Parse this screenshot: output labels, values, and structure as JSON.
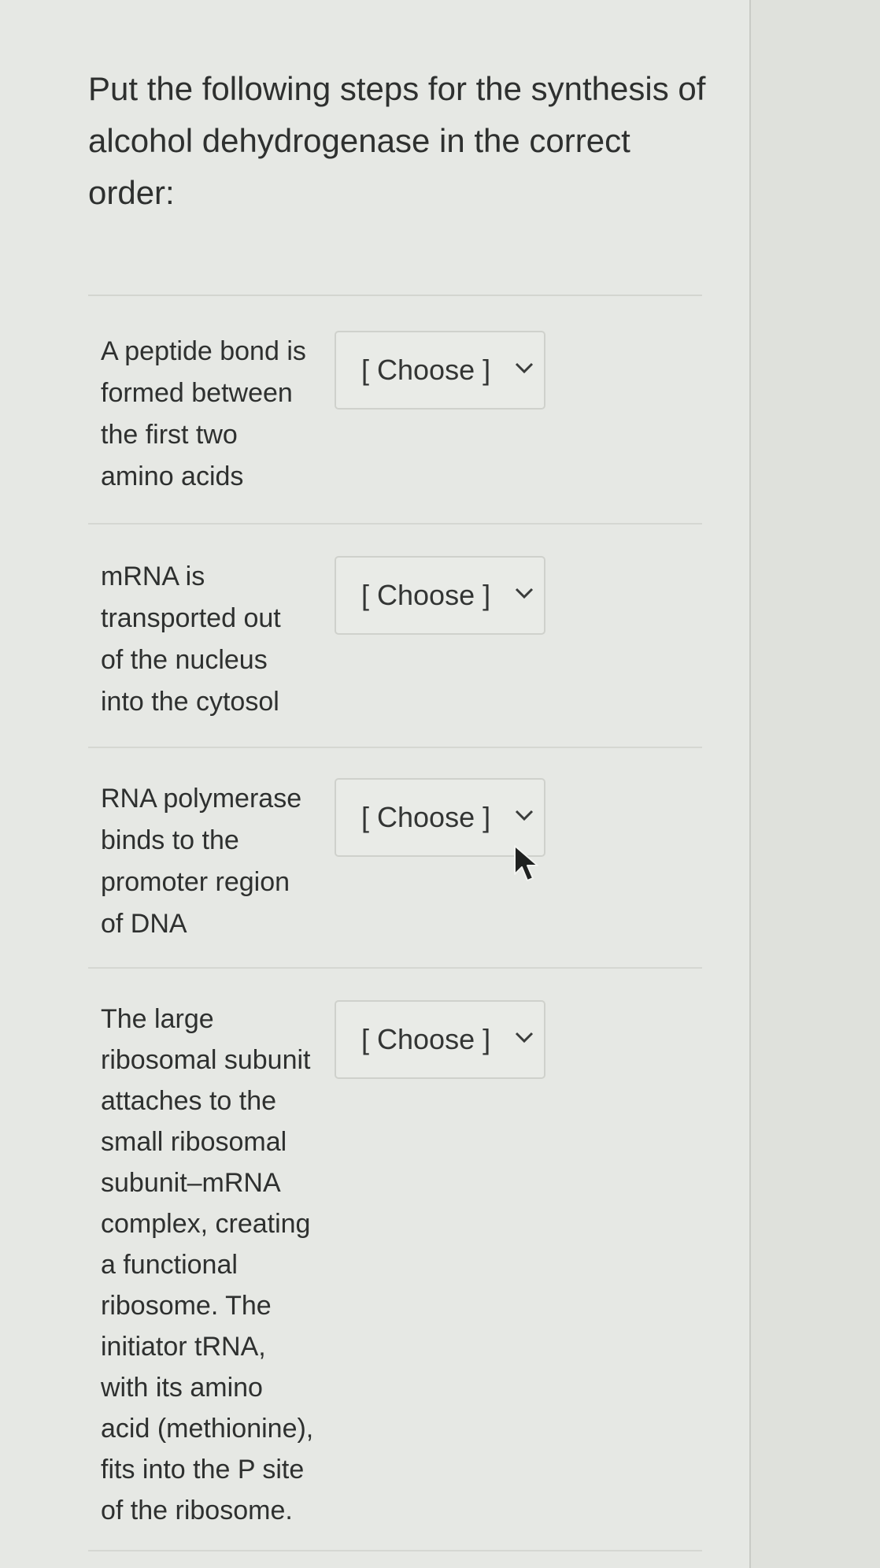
{
  "question": {
    "text": "Put the following steps for the synthesis of alcohol dehydrogenase in the correct order:"
  },
  "rows": [
    {
      "label": "A peptide bond is\nformed between\nthe first two\namino acids",
      "select_value": "[ Choose ]"
    },
    {
      "label": "mRNA is\ntransported out\nof the nucleus\ninto the cytosol",
      "select_value": "[ Choose ]"
    },
    {
      "label": "RNA polymerase\nbinds to the\npromoter region\nof DNA",
      "select_value": "[ Choose ]"
    },
    {
      "label": "The large\nribosomal subunit\nattaches to the\nsmall ribosomal\nsubunit–mRNA\ncomplex, creating\na functional\nribosome. The\ninitiator tRNA,\nwith its amino\nacid (methionine),\nfits into the P site\nof the ribosome.",
      "select_value": "[ Choose ]"
    }
  ],
  "icons": {
    "dropdown": "chevron-down-icon",
    "pointer": "mouse-cursor-icon"
  },
  "colors": {
    "background": "#e6e8e4",
    "text": "#2e302f",
    "border": "#cfd1cc"
  }
}
